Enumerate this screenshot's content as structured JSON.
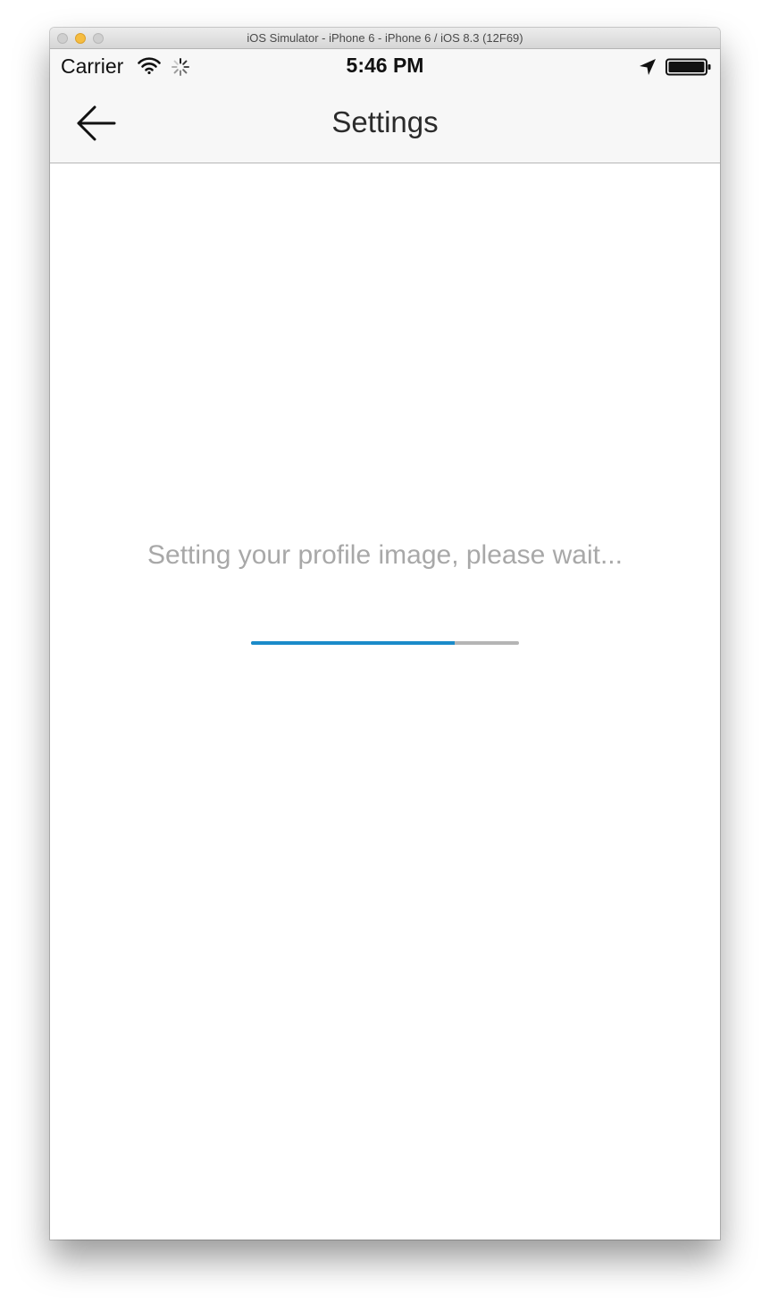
{
  "window": {
    "title": "iOS Simulator - iPhone 6 - iPhone 6 / iOS 8.3 (12F69)"
  },
  "status_bar": {
    "carrier": "Carrier",
    "time": "5:46 PM",
    "icons": [
      "wifi-icon",
      "activity-spinner-icon",
      "location-arrow-icon",
      "battery-icon"
    ]
  },
  "nav_bar": {
    "title": "Settings",
    "back_icon": "arrow-left-icon"
  },
  "content": {
    "message": "Setting your profile image, please wait...",
    "progress": 0.76
  },
  "colors": {
    "progress_fill": "#1a8bc9",
    "progress_track": "#b5b5b5",
    "message_text": "#a8a8a8",
    "bar_background": "#f7f7f7"
  }
}
